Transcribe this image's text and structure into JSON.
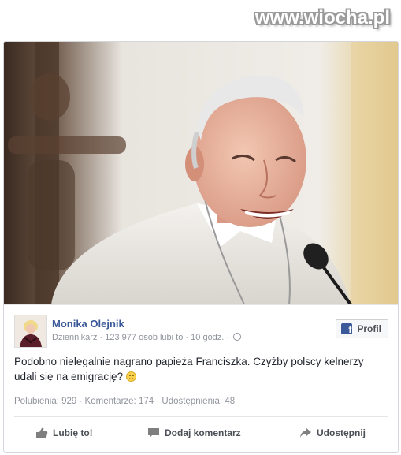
{
  "watermark": "www.wiocha.pl",
  "post": {
    "author": "Monika Olejnik",
    "meta": {
      "category": "Dziennikarz",
      "likes": "123 977 osób lubi to",
      "time": "10 godz.",
      "sep": "·"
    },
    "profile_button": "Profil",
    "text": "Podobno nielegalnie nagrano papieża Franciszka. Czyżby polscy kelnerzy udali się na emigrację?",
    "stats": {
      "likes": "Polubienia: 929",
      "comments": "Komentarze: 174",
      "shares": "Udostępnienia: 48",
      "sep": "·"
    },
    "actions": {
      "like": "Lubię to!",
      "comment": "Dodaj komentarz",
      "share": "Udostępnij"
    }
  },
  "colors": {
    "link": "#3b5998",
    "meta": "#90949c",
    "text": "#1d2129",
    "action": "#4b4f56"
  },
  "icons": [
    "facebook-icon",
    "globe-icon",
    "smiley-icon",
    "thumbs-up-icon",
    "comment-icon",
    "share-icon"
  ]
}
